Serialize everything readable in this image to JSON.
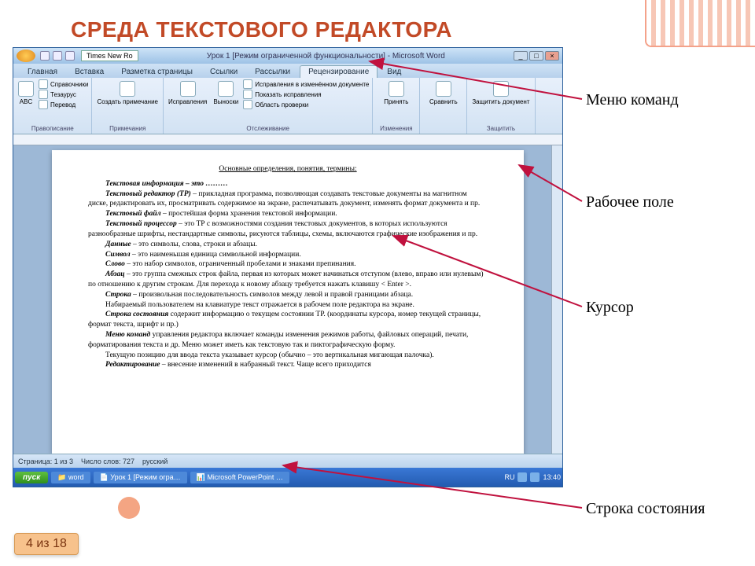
{
  "slide": {
    "title": "СРЕДА ТЕКСТОВОГО РЕДАКТОРА",
    "nav_label": "4 из 18"
  },
  "callouts": {
    "menu": "Меню команд",
    "workspace": "Рабочее поле",
    "cursor": "Курсор",
    "statusbar": "Строка состояния"
  },
  "word": {
    "font_name": "Times New Ro",
    "title": "Урок 1 [Режим ограниченной функциональности] - Microsoft Word",
    "tabs": [
      "Главная",
      "Вставка",
      "Разметка страницы",
      "Ссылки",
      "Рассылки",
      "Рецензирование",
      "Вид"
    ],
    "active_tab_index": 5,
    "ribbon": {
      "g1_label": "Правописание",
      "g1_btn": "ABC",
      "g1_items": [
        "Справочники",
        "Тезаурус",
        "Перевод"
      ],
      "g2_btn": "Создать примечание",
      "g2_label": "Примечания",
      "g3_btns": [
        "Исправления",
        "Выноски"
      ],
      "g3_items": [
        "Исправления в изменённом документе",
        "Показать исправления",
        "Область проверки"
      ],
      "g3_label": "Отслеживание",
      "g4_btn": "Принять",
      "g4_label": "Изменения",
      "g5_btn": "Сравнить",
      "g6_btn": "Защитить документ",
      "g6_label": "Защитить"
    },
    "doc": {
      "heading": "Основные определения, понятия, термины:",
      "p1": "Текстовая информация – это ………",
      "p2_b": "Текстовый редактор (ТР)",
      "p2": " – прикладная программа, позволяющая создавать текстовые документы на магнитном диске, редактировать их, просматривать содержимое на экране, распечатывать документ, изменять формат документа и пр.",
      "p3_b": "Текстовый файл",
      "p3": " – простейшая форма хранения текстовой информации.",
      "p4_b": "Текстовый процессор",
      "p4": " – это ТР с возможностями создания текстовых документов, в которых используются разнообразные шрифты, нестандартные символы, рисуются таблицы, схемы, включаются графические изображения и пр.",
      "p5_b": "Данные",
      "p5": " – это символы, слова, строки и абзацы.",
      "p6_b": "Символ",
      "p6": " – это наименьшая единица символьной информации.",
      "p7_b": "Слово",
      "p7": " – это набор символов, ограниченный пробелами и знаками препинания.",
      "p8_b": "Абзац",
      "p8": " – это группа смежных строк файла, первая из которых может начинаться отступом (влево, вправо или нулевым) по отношению к другим строкам. Для перехода к новому абзацу требуется нажать клавишу < Enter >.",
      "p9_b": "Строка",
      "p9": " – произвольная последовательность символов между левой и правой границами абзаца.",
      "p10": "Набираемый пользователем на клавиатуре текст отражается в рабочем поле редактора на экране.",
      "p11_b": "Строка состояния",
      "p11": " содержит информацию о текущем состоянии ТР. (координаты курсора, номер текущей страницы, формат текста, шрифт и пр.)",
      "p12_b": "Меню команд",
      "p12": " управления редактора включает команды изменения режимов работы, файловых операций, печати, форматирования текста и др. Меню может иметь как текстовую так и пиктографическую форму.",
      "p13": "Текущую позицию для ввода текста указывает курсор (обычно – это вертикальная мигающая палочка).",
      "p14_b": "Редактирование",
      "p14": " – внесение изменений в набранный текст. Чаще всего приходится"
    },
    "status": {
      "page": "Страница: 1 из 3",
      "words": "Число слов: 727",
      "lang": "русский"
    },
    "taskbar": {
      "start": "пуск",
      "task1": "word",
      "task2": "Урок 1 [Режим огра…",
      "task3": "Microsoft PowerPoint …",
      "lang": "RU",
      "time": "13:40"
    }
  }
}
